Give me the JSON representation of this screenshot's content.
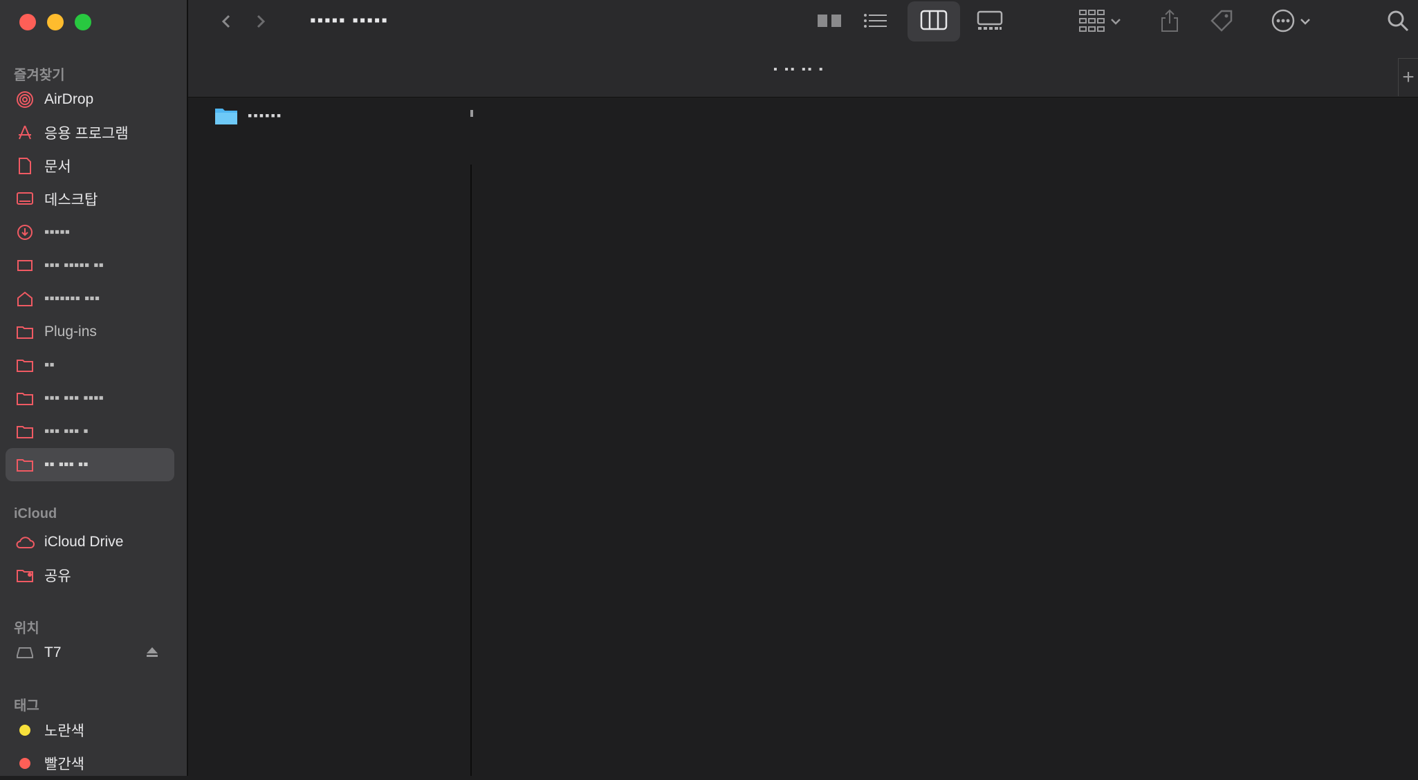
{
  "window": {
    "title_pixelated": "▪▪▪▪▪ ▪▪▪▪▪",
    "tab_title_pixelated": "▪ ▪▪ ▪▪ ▪"
  },
  "sidebar": {
    "favorites_title": "즐겨찾기",
    "favorites": [
      {
        "label": "AirDrop",
        "icon": "airdrop-icon"
      },
      {
        "label": "응용 프로그램",
        "icon": "applications-icon"
      },
      {
        "label": "문서",
        "icon": "document-icon"
      },
      {
        "label": "데스크탑",
        "icon": "desktop-icon"
      },
      {
        "label": "▪▪▪▪▪",
        "icon": "downloads-icon"
      },
      {
        "label": "▪▪▪ ▪▪▪▪▪ ▪▪",
        "icon": "harddisk-icon"
      },
      {
        "label": "▪▪▪▪▪▪▪ ▪▪▪",
        "icon": "home-icon"
      },
      {
        "label": "Plug-ins",
        "icon": "folder-icon"
      },
      {
        "label": "▪▪",
        "icon": "folder-icon"
      },
      {
        "label": "▪▪▪ ▪▪▪ ▪▪▪▪",
        "icon": "folder-icon"
      },
      {
        "label": "▪▪▪ ▪▪▪ ▪",
        "icon": "folder-icon"
      },
      {
        "label": "▪▪ ▪▪▪ ▪▪",
        "icon": "folder-icon"
      }
    ],
    "icloud_title": "iCloud",
    "icloud": [
      {
        "label": "iCloud Drive",
        "icon": "cloud-icon"
      },
      {
        "label": "공유",
        "icon": "shared-folder-icon"
      }
    ],
    "locations_title": "위치",
    "locations": [
      {
        "label": "T7",
        "icon": "external-drive-icon"
      }
    ],
    "tags_title": "태그",
    "tags": [
      {
        "label": "노란색",
        "color": "#f7e03b"
      },
      {
        "label": "빨간색",
        "color": "#fe5f57"
      }
    ]
  },
  "content": {
    "items": [
      {
        "name_pixelated": "▪▪▪▪▪▪",
        "icon": "folder-icon"
      }
    ]
  },
  "colors": {
    "accent_sidebar_icon": "#f05a63",
    "folder_blue": "#4fb6f1"
  }
}
